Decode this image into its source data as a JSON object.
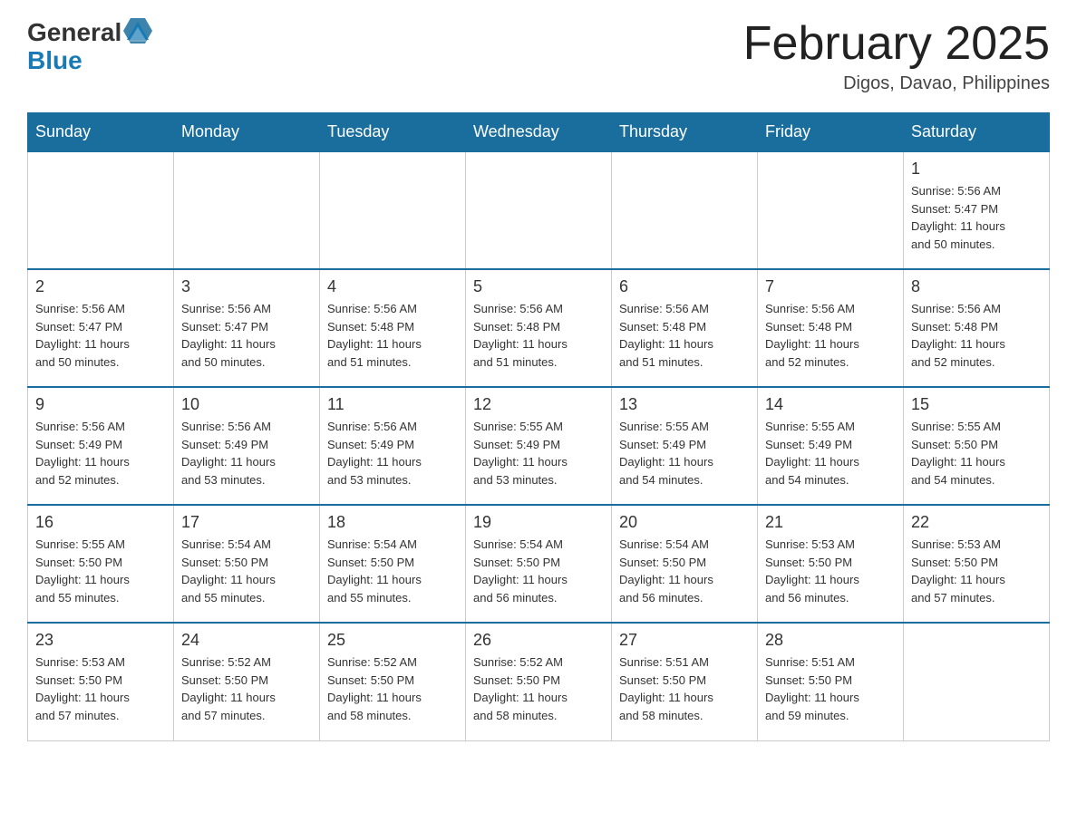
{
  "logo": {
    "general": "General",
    "blue": "Blue"
  },
  "title": "February 2025",
  "subtitle": "Digos, Davao, Philippines",
  "days_of_week": [
    "Sunday",
    "Monday",
    "Tuesday",
    "Wednesday",
    "Thursday",
    "Friday",
    "Saturday"
  ],
  "weeks": [
    [
      {
        "day": "",
        "info": ""
      },
      {
        "day": "",
        "info": ""
      },
      {
        "day": "",
        "info": ""
      },
      {
        "day": "",
        "info": ""
      },
      {
        "day": "",
        "info": ""
      },
      {
        "day": "",
        "info": ""
      },
      {
        "day": "1",
        "info": "Sunrise: 5:56 AM\nSunset: 5:47 PM\nDaylight: 11 hours\nand 50 minutes."
      }
    ],
    [
      {
        "day": "2",
        "info": "Sunrise: 5:56 AM\nSunset: 5:47 PM\nDaylight: 11 hours\nand 50 minutes."
      },
      {
        "day": "3",
        "info": "Sunrise: 5:56 AM\nSunset: 5:47 PM\nDaylight: 11 hours\nand 50 minutes."
      },
      {
        "day": "4",
        "info": "Sunrise: 5:56 AM\nSunset: 5:48 PM\nDaylight: 11 hours\nand 51 minutes."
      },
      {
        "day": "5",
        "info": "Sunrise: 5:56 AM\nSunset: 5:48 PM\nDaylight: 11 hours\nand 51 minutes."
      },
      {
        "day": "6",
        "info": "Sunrise: 5:56 AM\nSunset: 5:48 PM\nDaylight: 11 hours\nand 51 minutes."
      },
      {
        "day": "7",
        "info": "Sunrise: 5:56 AM\nSunset: 5:48 PM\nDaylight: 11 hours\nand 52 minutes."
      },
      {
        "day": "8",
        "info": "Sunrise: 5:56 AM\nSunset: 5:48 PM\nDaylight: 11 hours\nand 52 minutes."
      }
    ],
    [
      {
        "day": "9",
        "info": "Sunrise: 5:56 AM\nSunset: 5:49 PM\nDaylight: 11 hours\nand 52 minutes."
      },
      {
        "day": "10",
        "info": "Sunrise: 5:56 AM\nSunset: 5:49 PM\nDaylight: 11 hours\nand 53 minutes."
      },
      {
        "day": "11",
        "info": "Sunrise: 5:56 AM\nSunset: 5:49 PM\nDaylight: 11 hours\nand 53 minutes."
      },
      {
        "day": "12",
        "info": "Sunrise: 5:55 AM\nSunset: 5:49 PM\nDaylight: 11 hours\nand 53 minutes."
      },
      {
        "day": "13",
        "info": "Sunrise: 5:55 AM\nSunset: 5:49 PM\nDaylight: 11 hours\nand 54 minutes."
      },
      {
        "day": "14",
        "info": "Sunrise: 5:55 AM\nSunset: 5:49 PM\nDaylight: 11 hours\nand 54 minutes."
      },
      {
        "day": "15",
        "info": "Sunrise: 5:55 AM\nSunset: 5:50 PM\nDaylight: 11 hours\nand 54 minutes."
      }
    ],
    [
      {
        "day": "16",
        "info": "Sunrise: 5:55 AM\nSunset: 5:50 PM\nDaylight: 11 hours\nand 55 minutes."
      },
      {
        "day": "17",
        "info": "Sunrise: 5:54 AM\nSunset: 5:50 PM\nDaylight: 11 hours\nand 55 minutes."
      },
      {
        "day": "18",
        "info": "Sunrise: 5:54 AM\nSunset: 5:50 PM\nDaylight: 11 hours\nand 55 minutes."
      },
      {
        "day": "19",
        "info": "Sunrise: 5:54 AM\nSunset: 5:50 PM\nDaylight: 11 hours\nand 56 minutes."
      },
      {
        "day": "20",
        "info": "Sunrise: 5:54 AM\nSunset: 5:50 PM\nDaylight: 11 hours\nand 56 minutes."
      },
      {
        "day": "21",
        "info": "Sunrise: 5:53 AM\nSunset: 5:50 PM\nDaylight: 11 hours\nand 56 minutes."
      },
      {
        "day": "22",
        "info": "Sunrise: 5:53 AM\nSunset: 5:50 PM\nDaylight: 11 hours\nand 57 minutes."
      }
    ],
    [
      {
        "day": "23",
        "info": "Sunrise: 5:53 AM\nSunset: 5:50 PM\nDaylight: 11 hours\nand 57 minutes."
      },
      {
        "day": "24",
        "info": "Sunrise: 5:52 AM\nSunset: 5:50 PM\nDaylight: 11 hours\nand 57 minutes."
      },
      {
        "day": "25",
        "info": "Sunrise: 5:52 AM\nSunset: 5:50 PM\nDaylight: 11 hours\nand 58 minutes."
      },
      {
        "day": "26",
        "info": "Sunrise: 5:52 AM\nSunset: 5:50 PM\nDaylight: 11 hours\nand 58 minutes."
      },
      {
        "day": "27",
        "info": "Sunrise: 5:51 AM\nSunset: 5:50 PM\nDaylight: 11 hours\nand 58 minutes."
      },
      {
        "day": "28",
        "info": "Sunrise: 5:51 AM\nSunset: 5:50 PM\nDaylight: 11 hours\nand 59 minutes."
      },
      {
        "day": "",
        "info": ""
      }
    ]
  ]
}
